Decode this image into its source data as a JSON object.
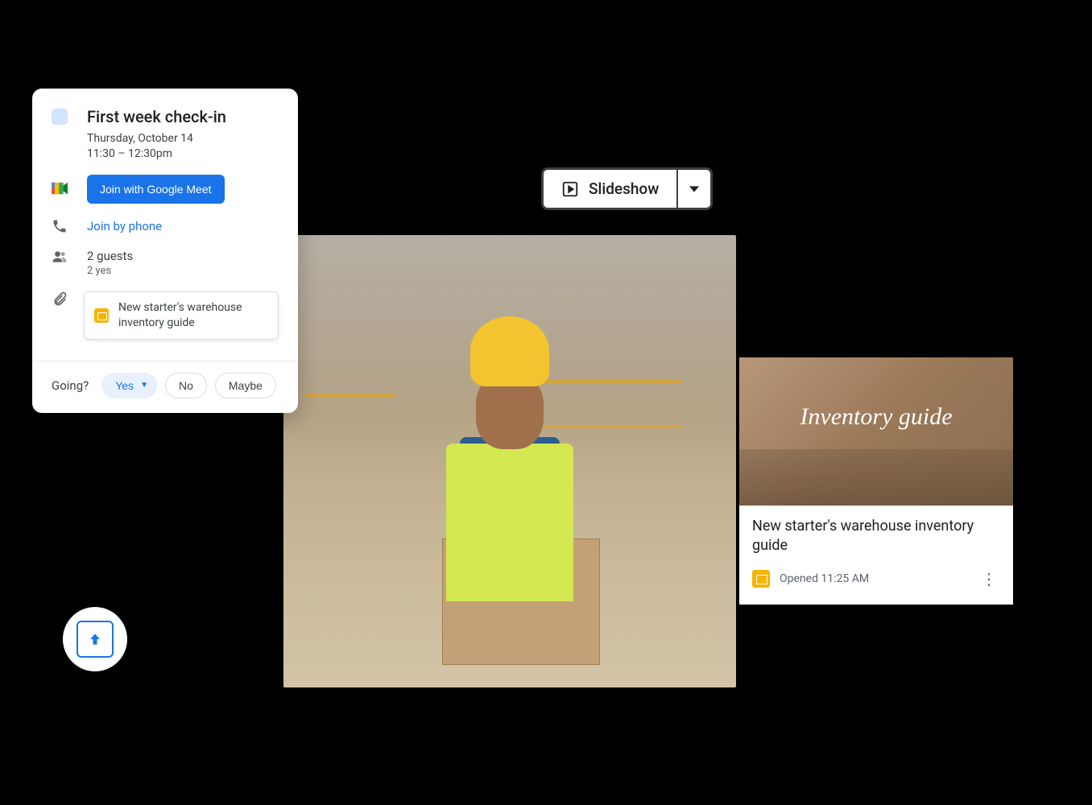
{
  "event": {
    "title": "First week check-in",
    "date": "Thursday, October 14",
    "time": "11:30 – 12:30pm",
    "meet_button": "Join with Google Meet",
    "phone_link": "Join by phone",
    "guests_count": "2 guests",
    "guests_status": "2 yes",
    "attachment_name": "New starter's warehouse inventory guide",
    "going_label": "Going?",
    "rsvp": {
      "yes": "Yes",
      "no": "No",
      "maybe": "Maybe"
    }
  },
  "slideshow_button": {
    "label": "Slideshow"
  },
  "file_card": {
    "thumb_title": "Inventory guide",
    "title": "New starter's warehouse inventory guide",
    "opened": "Opened 11:25 AM"
  },
  "icons": {
    "meet": "google-meet-icon",
    "phone": "phone-icon",
    "people": "people-icon",
    "attachment": "paperclip-icon",
    "slides": "google-slides-icon",
    "play": "play-box-icon",
    "dropdown": "dropdown-caret-icon",
    "more": "more-vert-icon",
    "upload": "upload-arrow-icon"
  },
  "colors": {
    "primary_blue": "#1a73e8",
    "event_swatch": "#d2e3fc",
    "slides_yellow": "#f5b400",
    "text_primary": "#202124",
    "text_secondary": "#5f6368",
    "safety_vest": "#d4e852",
    "hardhat": "#f4c430"
  }
}
